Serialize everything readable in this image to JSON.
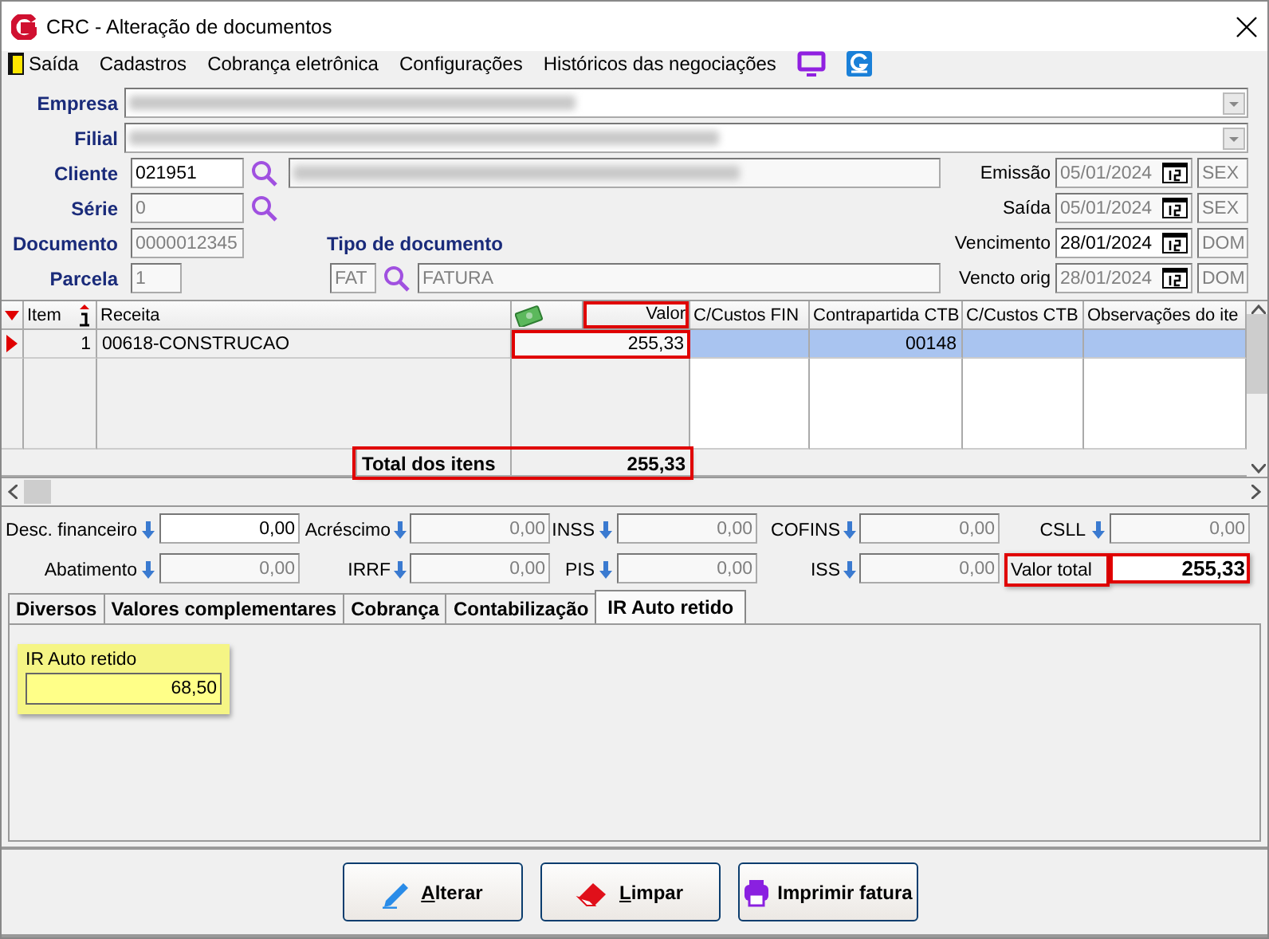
{
  "window": {
    "title": "CRC - Alteração de documentos"
  },
  "menu": [
    {
      "label": "Saída"
    },
    {
      "label": "Cadastros"
    },
    {
      "label": "Cobrança eletrônica"
    },
    {
      "label": "Configurações"
    },
    {
      "label": "Históricos das negociações"
    }
  ],
  "header": {
    "empresa": {
      "label": "Empresa"
    },
    "filial": {
      "label": "Filial"
    },
    "cliente": {
      "label": "Cliente",
      "code": "021951",
      "disabled": false
    },
    "serie": {
      "label": "Série",
      "value": "0",
      "disabled": true
    },
    "documento": {
      "label": "Documento",
      "value": "0000012345",
      "disabled": true
    },
    "parcela": {
      "label": "Parcela",
      "value": "1",
      "disabled": true
    },
    "tipo_documento": {
      "label": "Tipo de documento",
      "code": "FAT",
      "name": "FATURA",
      "disabled": true
    },
    "dates": [
      {
        "label": "Emissão",
        "value": "05/01/2024",
        "weekday": "SEX",
        "disabled": true
      },
      {
        "label": "Saída",
        "value": "05/01/2024",
        "weekday": "SEX",
        "disabled": true
      },
      {
        "label": "Vencimento",
        "value": "28/01/2024",
        "weekday": "DOM",
        "disabled": false
      },
      {
        "label": "Vencto orig",
        "value": "28/01/2024",
        "weekday": "DOM",
        "disabled": true
      }
    ]
  },
  "grid": {
    "columns": [
      {
        "label": "Item",
        "highlighted": false
      },
      {
        "label": "Receita",
        "highlighted": false
      },
      {
        "label": "Valor",
        "highlighted": true
      },
      {
        "label": "C/Custos FIN",
        "highlighted": false
      },
      {
        "label": "Contrapartida CTB",
        "highlighted": false
      },
      {
        "label": "C/Custos CTB",
        "highlighted": false
      },
      {
        "label": "Observações do ite",
        "highlighted": false
      }
    ],
    "rows": [
      {
        "selected": true,
        "item": "1",
        "receita": "00618-CONSTRUCAO",
        "valor": "255,33",
        "contrapartida_ctb": "00148"
      }
    ],
    "total": {
      "label": "Total dos itens",
      "value": "255,33",
      "highlighted": true
    }
  },
  "summary": [
    {
      "kind": "field",
      "label": "Desc. financeiro",
      "value": "0,00",
      "disabled": false
    },
    {
      "kind": "field",
      "label": "Acréscimo",
      "value": "0,00",
      "disabled": true
    },
    {
      "kind": "field",
      "label": "INSS",
      "value": "0,00",
      "disabled": true
    },
    {
      "kind": "field",
      "label": "COFINS",
      "value": "0,00",
      "disabled": true
    },
    {
      "kind": "field",
      "label": "CSLL",
      "value": "0,00",
      "disabled": true
    },
    {
      "kind": "field",
      "label": "Abatimento",
      "value": "0,00",
      "disabled": true
    },
    {
      "kind": "field",
      "label": "IRRF",
      "value": "0,00",
      "disabled": true
    },
    {
      "kind": "field",
      "label": "PIS",
      "value": "0,00",
      "disabled": true
    },
    {
      "kind": "field",
      "label": "ISS",
      "value": "0,00",
      "disabled": true
    },
    {
      "kind": "total",
      "label": "Valor total",
      "value": "255,33",
      "highlighted": true
    }
  ],
  "tabs": [
    {
      "label": "Diversos",
      "selected": false
    },
    {
      "label": "Valores complementares",
      "selected": false
    },
    {
      "label": "Cobrança",
      "selected": false
    },
    {
      "label": "Contabilização",
      "selected": false
    },
    {
      "label": "IR Auto retido",
      "selected": true
    }
  ],
  "ir_panel": {
    "label": "IR Auto retido",
    "value": "68,50"
  },
  "buttons": [
    {
      "kind": "edit",
      "label": "Alterar",
      "mnemonic": true
    },
    {
      "kind": "clear",
      "label": "Limpar",
      "mnemonic": true
    },
    {
      "kind": "print",
      "label": "Imprimir fatura",
      "mnemonic": false
    }
  ]
}
